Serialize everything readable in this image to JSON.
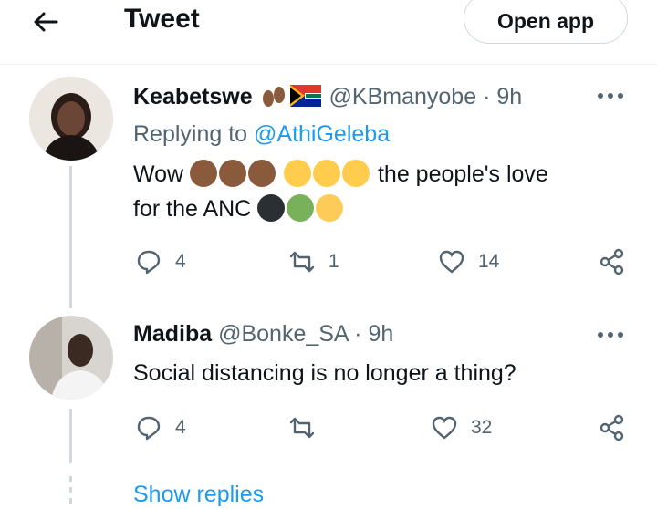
{
  "header": {
    "title": "Tweet",
    "open_app": "Open app"
  },
  "tweet1": {
    "name": "Keabetswe",
    "handle": "@KBmanyobe",
    "sep": "·",
    "time": "9h",
    "replying_prefix": "Replying to",
    "replying_handle": "@AthiGeleba",
    "text_a": "Wow",
    "text_b": "the people's love",
    "text_c": "for the ANC",
    "emoji_names": [
      "footprints-emoji",
      "south-africa-flag-emoji",
      "fist-emoji",
      "surprised-face-emoji",
      "black-heart-emoji",
      "green-heart-emoji",
      "yellow-heart-emoji"
    ],
    "replies": "4",
    "retweets": "1",
    "likes": "14"
  },
  "tweet2": {
    "name": "Madiba",
    "handle": "@Bonke_SA",
    "sep": "·",
    "time": "9h",
    "text": "Social distancing is no longer a thing?",
    "replies": "4",
    "retweets": "",
    "likes": "32"
  },
  "show_replies": "Show replies",
  "colors": {
    "link": "#1d9bf0",
    "muted": "#536471",
    "divider": "#eff3f4"
  }
}
